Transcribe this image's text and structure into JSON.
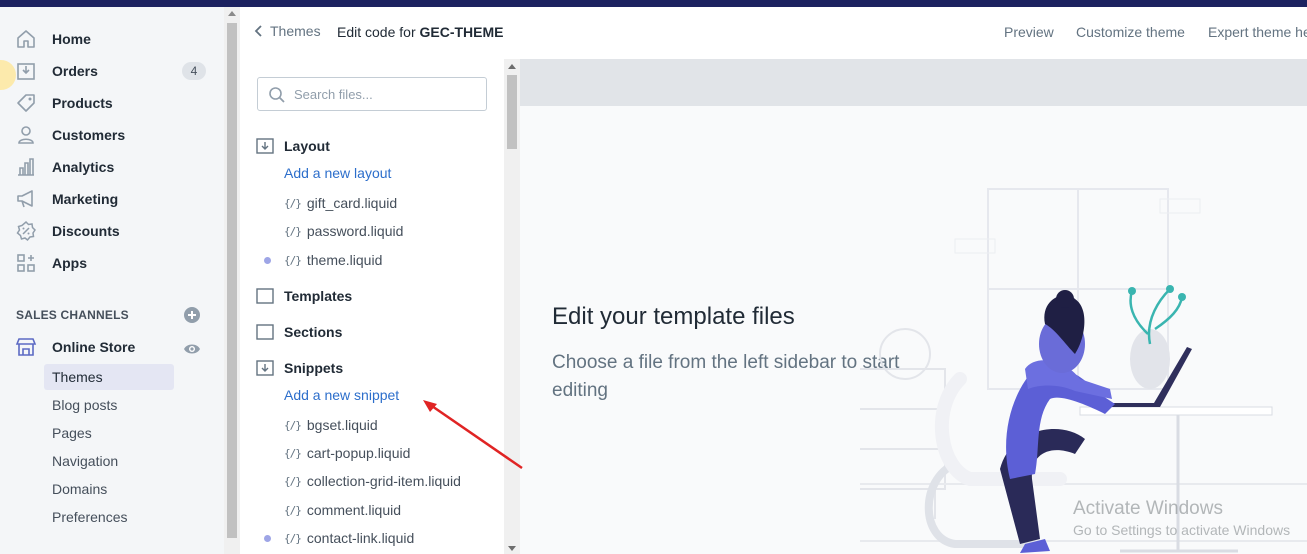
{
  "nav": {
    "items": [
      {
        "label": "Home",
        "icon": "home-icon"
      },
      {
        "label": "Orders",
        "icon": "orders-icon",
        "badge": "4"
      },
      {
        "label": "Products",
        "icon": "tag-icon"
      },
      {
        "label": "Customers",
        "icon": "person-icon"
      },
      {
        "label": "Analytics",
        "icon": "bar-chart-icon"
      },
      {
        "label": "Marketing",
        "icon": "megaphone-icon"
      },
      {
        "label": "Discounts",
        "icon": "discount-icon"
      },
      {
        "label": "Apps",
        "icon": "apps-icon"
      }
    ],
    "sales_channels_title": "SALES CHANNELS",
    "online_store": "Online Store",
    "sub_items": [
      "Themes",
      "Blog posts",
      "Pages",
      "Navigation",
      "Domains",
      "Preferences"
    ],
    "active_sub_item": "Themes"
  },
  "header": {
    "back_label": "Themes",
    "title_prefix": "Edit code for ",
    "theme_name": "GEC-THEME",
    "actions": [
      "Preview",
      "Customize theme",
      "Expert theme he"
    ]
  },
  "sidebar": {
    "search_placeholder": "Search files...",
    "layout": {
      "label": "Layout",
      "add": "Add a new layout",
      "files": [
        "gift_card.liquid",
        "password.liquid",
        "theme.liquid"
      ]
    },
    "templates_label": "Templates",
    "sections_label": "Sections",
    "snippets": {
      "label": "Snippets",
      "add": "Add a new snippet",
      "files": [
        "bgset.liquid",
        "cart-popup.liquid",
        "collection-grid-item.liquid",
        "comment.liquid",
        "contact-link.liquid"
      ]
    },
    "file_brace": "{/}"
  },
  "main": {
    "empty_title": "Edit your template files",
    "empty_text": "Choose a file from the left sidebar to start editing"
  },
  "watermark": {
    "line1": "Activate Windows",
    "line2": "Go to Settings to activate Windows"
  },
  "colors": {
    "topbar": "#1c2260",
    "link": "#2c6ecb",
    "active_bg": "#e4e6f3",
    "annotation_arrow": "#e02424",
    "illustration": "#5c5fd6"
  }
}
